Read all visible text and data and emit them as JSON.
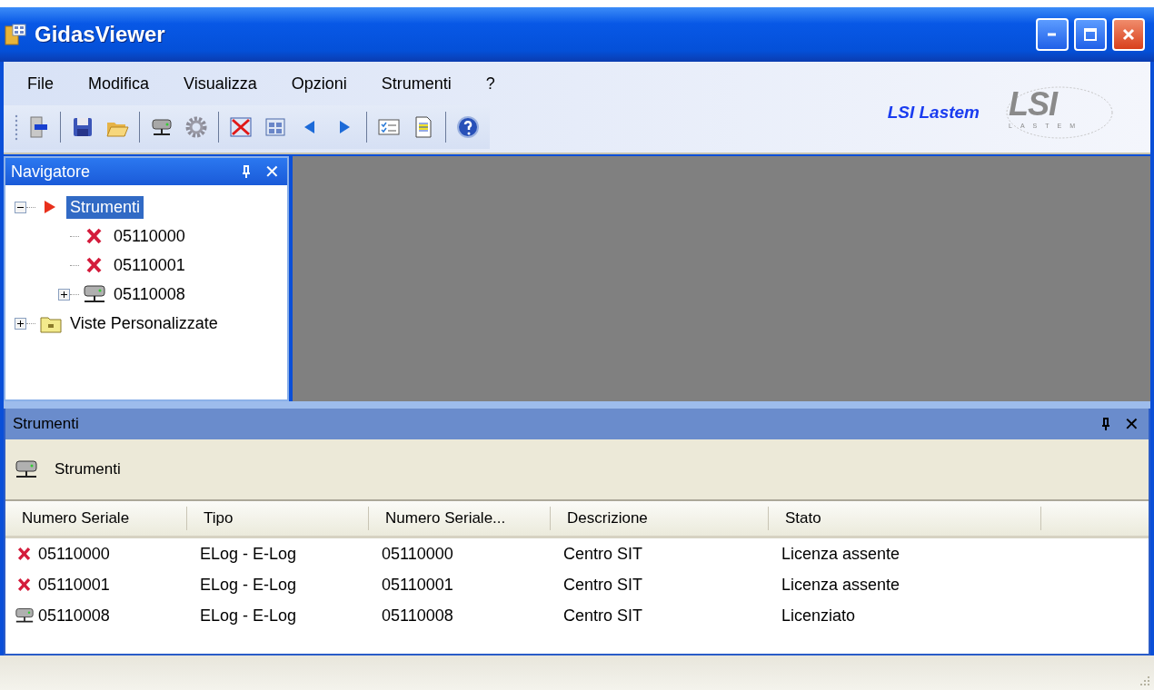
{
  "window": {
    "title": "GidasViewer"
  },
  "menu": [
    {
      "label": "File"
    },
    {
      "label": "Modifica"
    },
    {
      "label": "Visualizza"
    },
    {
      "label": "Opzioni"
    },
    {
      "label": "Strumenti"
    },
    {
      "label": "?"
    }
  ],
  "toolbar": [
    {
      "kind": "exit"
    },
    {
      "kind": "separator"
    },
    {
      "kind": "save"
    },
    {
      "kind": "open"
    },
    {
      "kind": "separator"
    },
    {
      "kind": "device"
    },
    {
      "kind": "gear"
    },
    {
      "kind": "separator"
    },
    {
      "kind": "delete"
    },
    {
      "kind": "grid"
    },
    {
      "kind": "prev"
    },
    {
      "kind": "next"
    },
    {
      "kind": "separator"
    },
    {
      "kind": "checklist"
    },
    {
      "kind": "report"
    },
    {
      "kind": "separator"
    },
    {
      "kind": "help"
    }
  ],
  "brand": {
    "name": "LSI Lastem",
    "logo_text": "LSI",
    "logo_subtext": "LASTEM"
  },
  "navigator": {
    "title": "Navigatore",
    "close": "✕",
    "tree": [
      {
        "label": "Strumenti",
        "kind": "root",
        "selected": true,
        "expanded": true,
        "children": [
          {
            "label": "05110000",
            "kind": "error",
            "selected": false
          },
          {
            "label": "05110001",
            "kind": "error",
            "selected": false
          },
          {
            "label": "05110008",
            "kind": "device",
            "selected": false,
            "expanded": false
          }
        ]
      },
      {
        "label": "Viste Personalizzate",
        "kind": "folder",
        "selected": false,
        "expanded": false
      }
    ]
  },
  "panel": {
    "title": "Strumenti",
    "close": "✕",
    "toolbar_label": "Strumenti",
    "table": {
      "columns": [
        "Numero Seriale",
        "Tipo",
        "Numero Seriale...",
        "Descrizione",
        "Stato"
      ],
      "rows": [
        {
          "kind": "error",
          "cells": [
            "05110000",
            "ELog - E-Log",
            "05110000",
            "Centro SIT",
            "Licenza assente"
          ]
        },
        {
          "kind": "error",
          "cells": [
            "05110001",
            "ELog - E-Log",
            "05110001",
            "Centro SIT",
            "Licenza assente"
          ]
        },
        {
          "kind": "device",
          "cells": [
            "05110008",
            "ELog - E-Log",
            "05110008",
            "Centro SIT",
            "Licenziato"
          ]
        }
      ]
    }
  }
}
